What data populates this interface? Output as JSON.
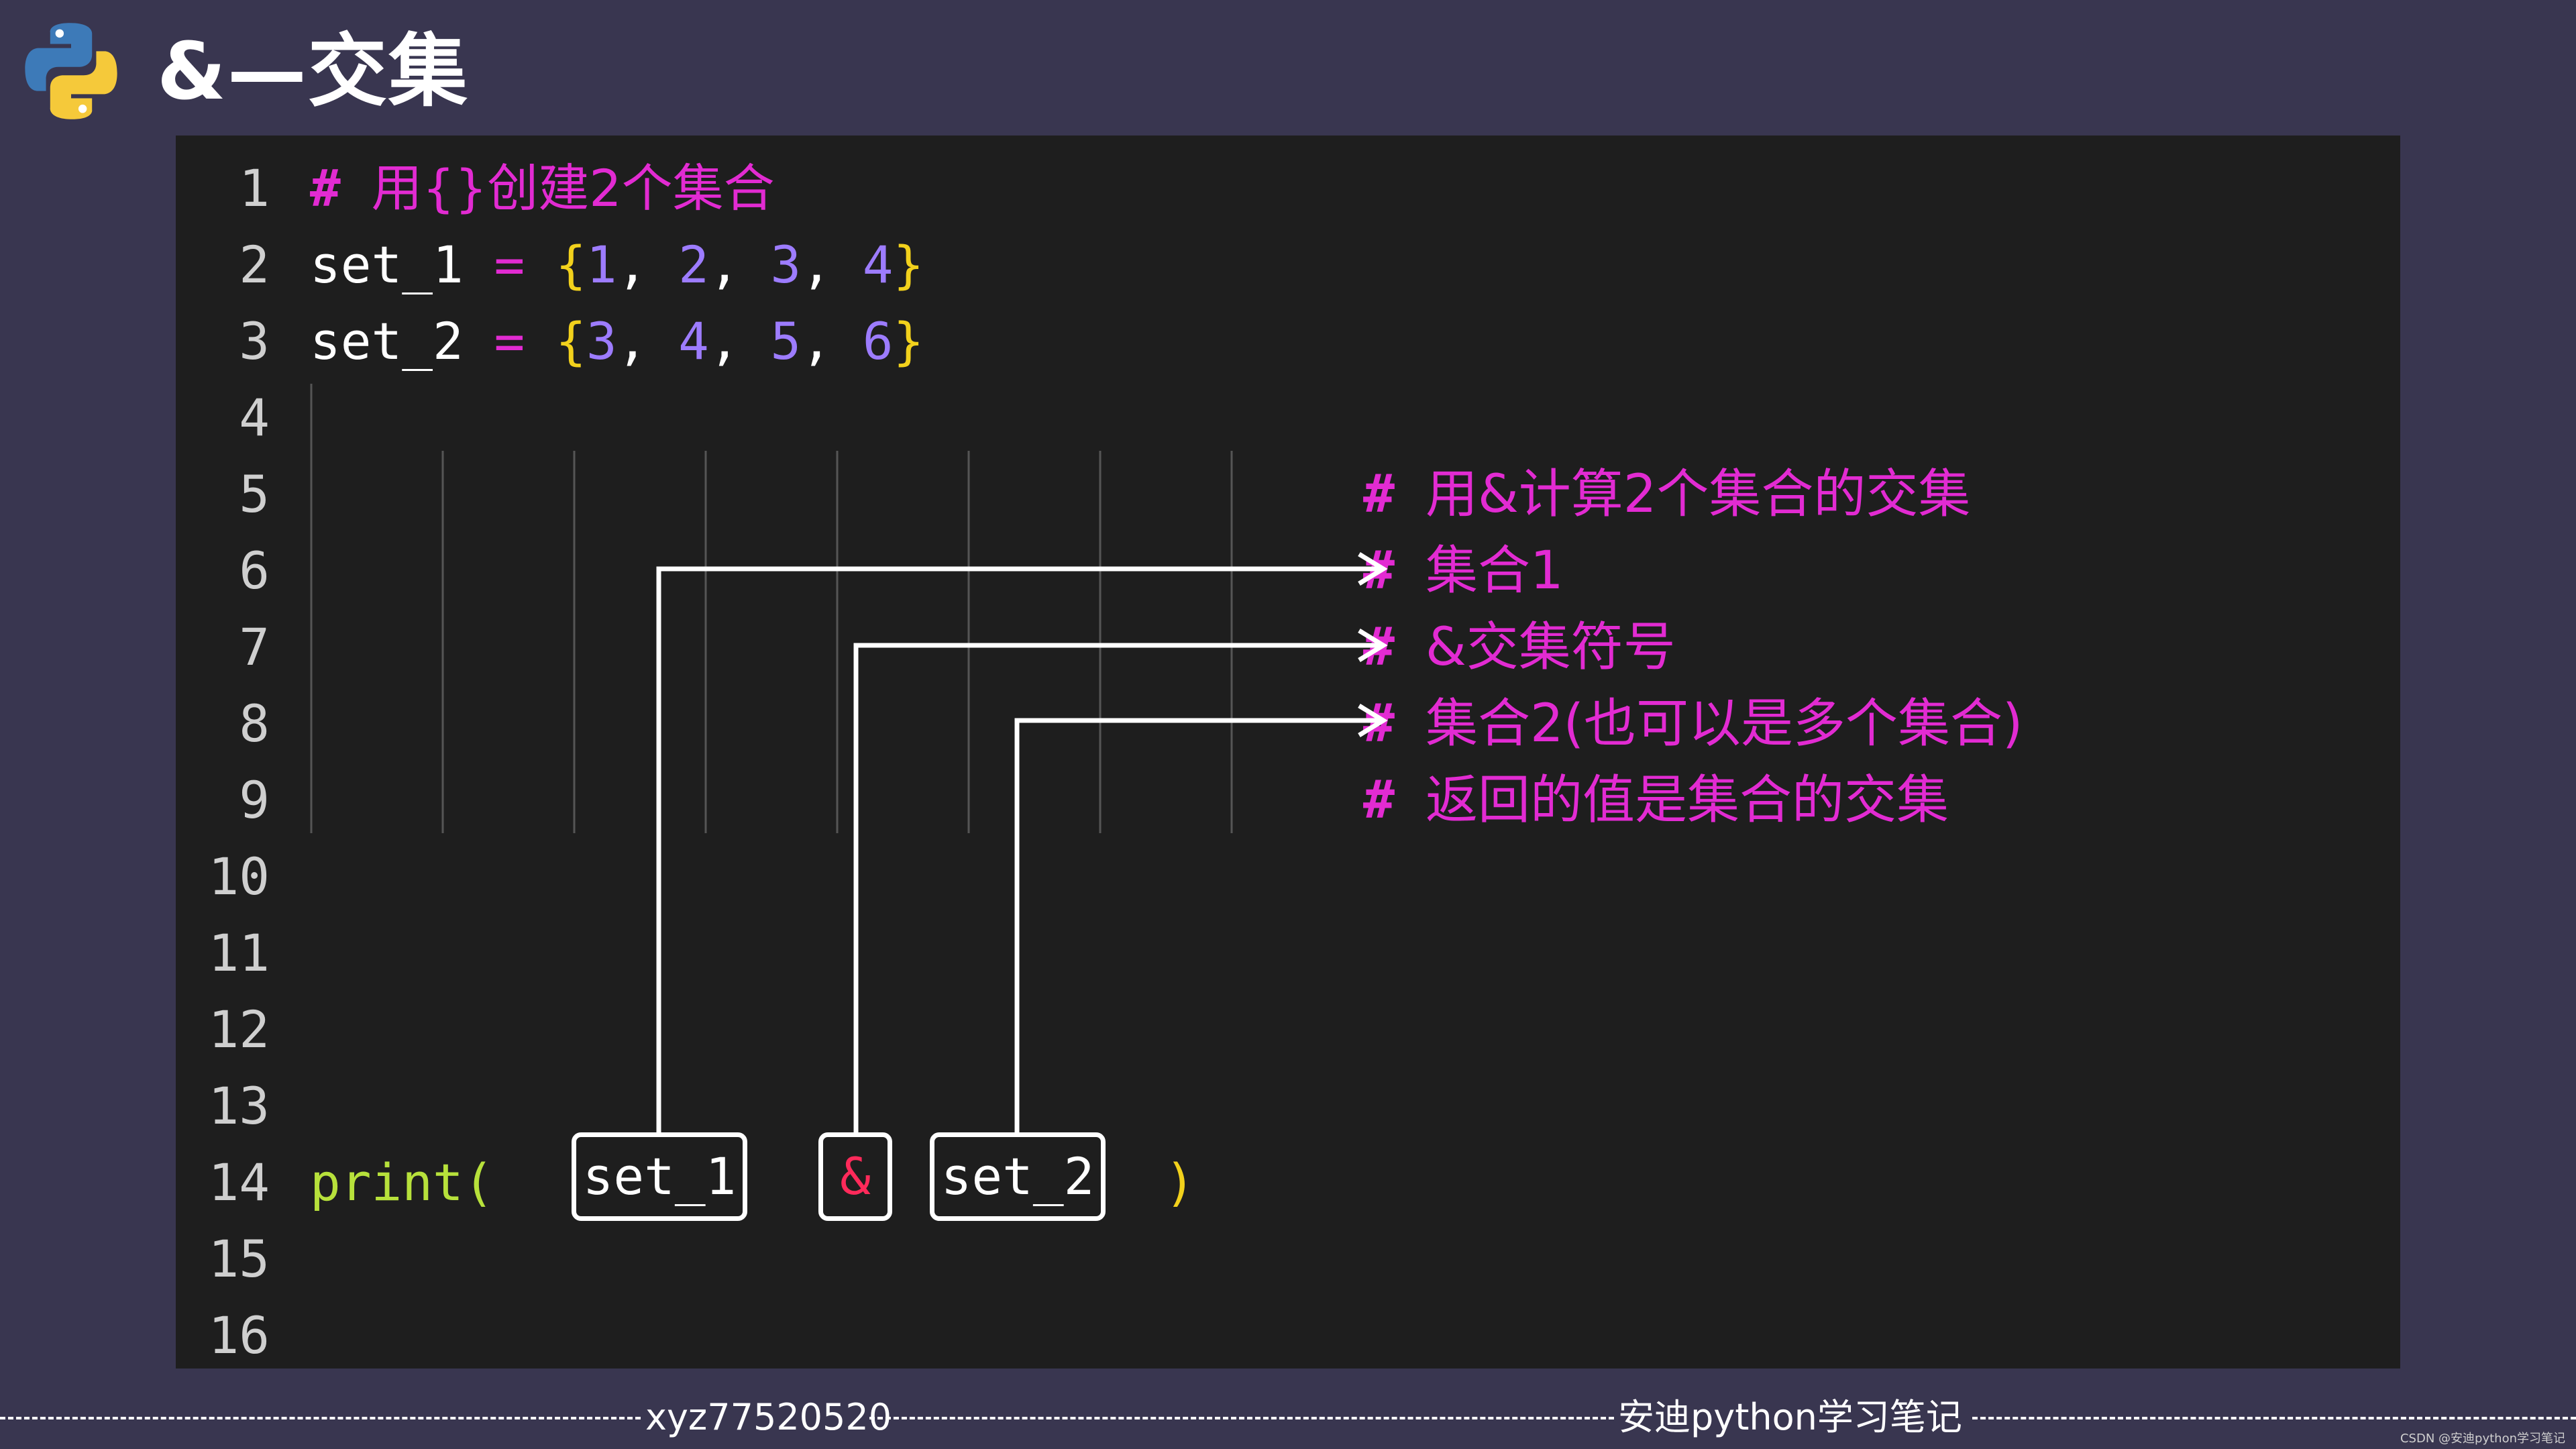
{
  "title": "&—交集",
  "logo": "python-logo",
  "colors": {
    "background": "#393650",
    "editor_background": "#1e1e1e",
    "comment": "#e22bd2",
    "number": "#9d7cff",
    "brace": "#f2d11c",
    "function": "#b7e13b",
    "ampersand": "#ff2a5a"
  },
  "line_numbers": [
    "1",
    "2",
    "3",
    "4",
    "5",
    "6",
    "7",
    "8",
    "9",
    "10",
    "11",
    "12",
    "13",
    "14",
    "15",
    "16"
  ],
  "code": {
    "line1": {
      "hash": "#",
      "text": "用{}创建2个集合"
    },
    "line2": {
      "var": "set_1",
      "op": "=",
      "open": "{",
      "values": [
        "1",
        "2",
        "3",
        "4"
      ],
      "close": "}"
    },
    "line3": {
      "var": "set_2",
      "op": "=",
      "open": "{",
      "values": [
        "3",
        "4",
        "5",
        "6"
      ],
      "close": "}"
    },
    "line14": {
      "func": "print(",
      "arg1": "set_1",
      "operator": "&",
      "arg2": "set_2",
      "close": ")"
    }
  },
  "annotations": [
    {
      "hash": "#",
      "text": "用&计算2个集合的交集"
    },
    {
      "hash": "#",
      "text": "集合1"
    },
    {
      "hash": "#",
      "text": "&交集符号"
    },
    {
      "hash": "#",
      "text": "集合2(也可以是多个集合)"
    },
    {
      "hash": "#",
      "text": "返回的值是集合的交集"
    }
  ],
  "footer": {
    "left": "xyz77520520",
    "right": "安迪python学习笔记",
    "credit": "CSDN @安迪python学习笔记"
  }
}
